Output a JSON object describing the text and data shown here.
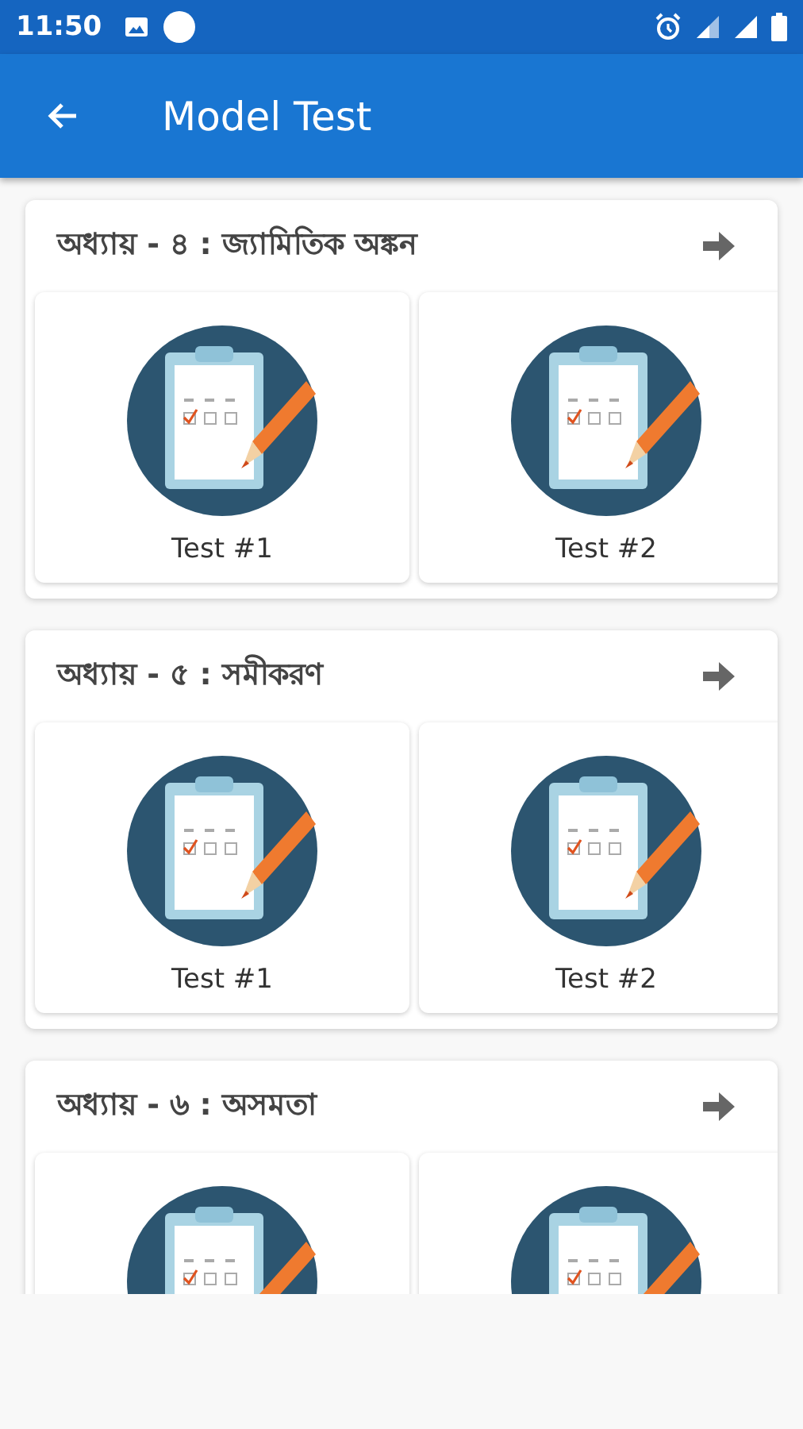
{
  "status_bar": {
    "time": "11:50"
  },
  "app_bar": {
    "title": "Model Test"
  },
  "sections": [
    {
      "title": "অধ্যায় - ৪ : জ্যামিতিক অঙ্কন",
      "tests": [
        {
          "kind": "test",
          "label": "Test #1"
        },
        {
          "kind": "test",
          "label": "Test #2"
        }
      ]
    },
    {
      "title": "অধ্যায় - ৫ : সমীকরণ",
      "tests": [
        {
          "kind": "test",
          "label": "Test #1"
        },
        {
          "kind": "test",
          "label": "Test #2"
        }
      ]
    },
    {
      "title": "অধ্যায় - ৬ : অসমতা",
      "tests": [
        {
          "kind": "test"
        },
        {
          "kind": "test"
        }
      ]
    }
  ]
}
